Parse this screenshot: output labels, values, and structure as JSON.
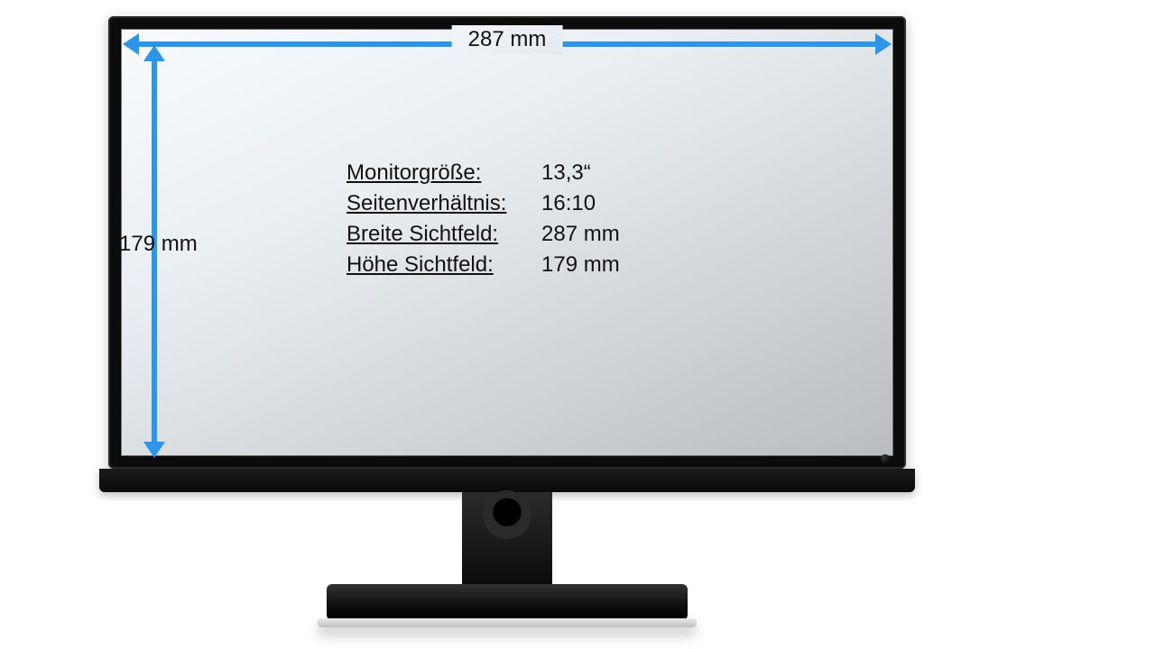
{
  "dimensions": {
    "width_label": "287 mm",
    "height_label": "179 mm"
  },
  "specs": {
    "rows": [
      {
        "key": "Monitorgröße:",
        "value": "13,3“"
      },
      {
        "key": "Seitenverhältnis:",
        "value": "16:10"
      },
      {
        "key": "Breite Sichtfeld:",
        "value": "287 mm"
      },
      {
        "key": "Höhe Sichtfeld:",
        "value": "179 mm"
      }
    ]
  },
  "colors": {
    "arrow": "#2b95ec"
  }
}
